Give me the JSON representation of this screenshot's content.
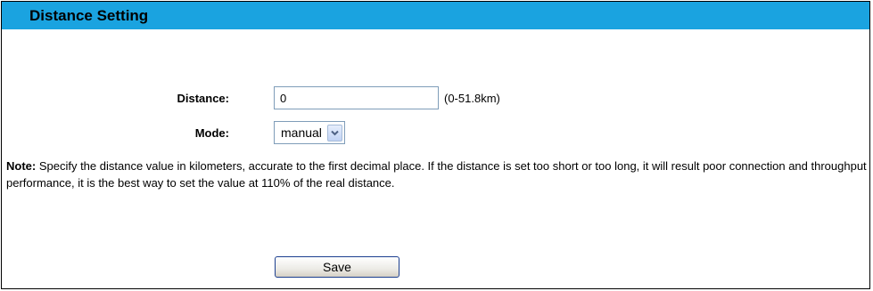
{
  "header": {
    "title": "Distance Setting",
    "background_color": "#1aa3e0"
  },
  "form": {
    "distance": {
      "label": "Distance:",
      "value": "0",
      "range_hint": "(0-51.8km)"
    },
    "mode": {
      "label": "Mode:",
      "selected": "manual",
      "icon": "chevron-down-icon"
    }
  },
  "note": {
    "label": "Note:",
    "text": " Specify the distance value in kilometers, accurate to the first decimal place. If the distance is set too short or too long, it will result poor connection and throughput performance, it is the best way to set the value at 110% of the real distance."
  },
  "actions": {
    "save_label": "Save"
  }
}
